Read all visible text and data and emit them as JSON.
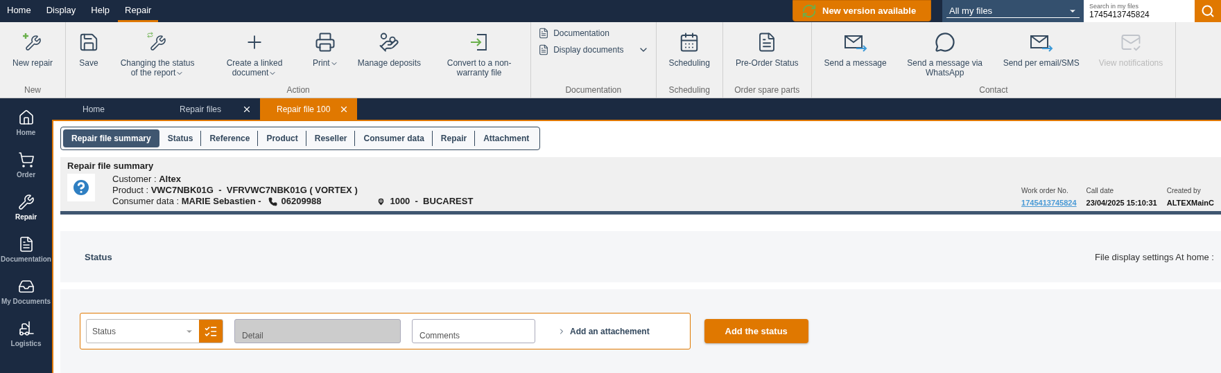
{
  "menu": [
    {
      "label": "Home",
      "selected": false
    },
    {
      "label": "Display",
      "selected": false
    },
    {
      "label": "Help",
      "selected": false
    },
    {
      "label": "Repair",
      "selected": true
    }
  ],
  "update_button": "New version available",
  "file_scope": "All my files",
  "search": {
    "label": "Search in my files",
    "value": "1745413745824"
  },
  "ribbon": [
    {
      "title": "New",
      "items": [
        {
          "kind": "large",
          "label": "New repair",
          "dropdown": false
        }
      ]
    },
    {
      "title": "Action",
      "items": [
        {
          "kind": "large",
          "label": "Save",
          "dropdown": false
        },
        {
          "kind": "large",
          "label": "Changing the status of the report",
          "dropdown": true
        },
        {
          "kind": "large",
          "label": "Create a linked document",
          "dropdown": true
        },
        {
          "kind": "large",
          "label": "Print",
          "dropdown": true
        },
        {
          "kind": "large",
          "label": "Manage deposits",
          "dropdown": false
        },
        {
          "kind": "large",
          "label": "Convert to a non-warranty file",
          "dropdown": false
        }
      ]
    },
    {
      "title": "Documentation",
      "items": [
        {
          "kind": "small",
          "label": "Documentation",
          "dropdown": false
        },
        {
          "kind": "small",
          "label": "Display documents",
          "dropdown": true
        }
      ]
    },
    {
      "title": "Scheduling",
      "items": [
        {
          "kind": "large",
          "label": "Scheduling",
          "dropdown": false
        }
      ]
    },
    {
      "title": "Order spare parts",
      "items": [
        {
          "kind": "large",
          "label": "Pre-Order Status",
          "dropdown": false
        }
      ]
    },
    {
      "title": "Contact",
      "items": [
        {
          "kind": "large",
          "label": "Send a message",
          "dropdown": false,
          "disabled": false
        },
        {
          "kind": "large",
          "label": "Send a message via WhatsApp",
          "dropdown": false,
          "disabled": false
        },
        {
          "kind": "large",
          "label": "Send per email/SMS",
          "dropdown": false,
          "disabled": false
        },
        {
          "kind": "large",
          "label": "View notifications",
          "dropdown": false,
          "disabled": true
        }
      ]
    }
  ],
  "sidebar": [
    {
      "label": "Home",
      "selected": false
    },
    {
      "label": "Order",
      "selected": false
    },
    {
      "label": "Repair",
      "selected": true
    },
    {
      "label": "Documentation",
      "selected": false
    },
    {
      "label": "My Documents",
      "selected": false
    },
    {
      "label": "Logistics",
      "selected": false
    }
  ],
  "tabs": [
    {
      "label": "Home",
      "closable": false,
      "selected": false
    },
    {
      "label": "Repair files",
      "closable": true,
      "selected": false
    },
    {
      "label": "Repair file 100",
      "closable": true,
      "selected": true
    }
  ],
  "section_tabs": [
    {
      "label": "Repair file summary",
      "selected": true
    },
    {
      "label": "Status",
      "selected": false
    },
    {
      "label": "Reference",
      "selected": false
    },
    {
      "label": "Product",
      "selected": false
    },
    {
      "label": "Reseller",
      "selected": false
    },
    {
      "label": "Consumer data",
      "selected": false
    },
    {
      "label": "Repair",
      "selected": false
    },
    {
      "label": "Attachment",
      "selected": false
    }
  ],
  "summary": {
    "title": "Repair file summary",
    "lines": [
      "Customer : **Altex**",
      "Product : **VWC7NBK01G  -  VFRVWC7NBK01G ( VORTEX )**"
    ],
    "consumer": "Consumer data : **MARIE Sebastien -**",
    "phone": "06209988",
    "location": "1000  -  BUCAREST",
    "meta": [
      {
        "label": "Work order No.",
        "value": "1745413745824",
        "kind": "link"
      },
      {
        "label": "Call date",
        "value": "23/04/2025 15:10:31",
        "kind": "text"
      },
      {
        "label": "Created by",
        "value": "ALTEXMainC",
        "kind": "text"
      }
    ]
  },
  "status_section": {
    "title": "Status",
    "settings": "File display settings At home :"
  },
  "status_form": {
    "status": {
      "placeholder": "Status"
    },
    "detail": {
      "placeholder": "Detail",
      "disabled": true
    },
    "comments": {
      "placeholder": "Comments"
    },
    "attachment": "Add an attachement",
    "submit": "Add the status"
  }
}
